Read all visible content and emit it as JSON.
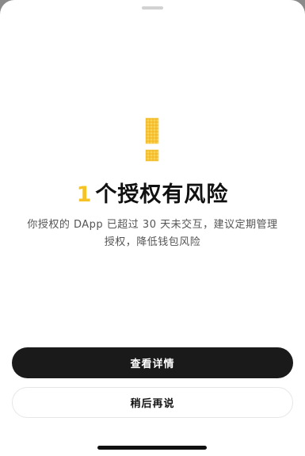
{
  "sheet": {
    "risk_count": "1",
    "title": "个授权有风险",
    "description": "你授权的 DApp 已超过 30 天未交互，建议定期管理授权，降低钱包风险",
    "icon": "warning-exclamation-icon",
    "accent_color": "#f5c327"
  },
  "actions": {
    "view_details_label": "查看详情",
    "later_label": "稍后再说"
  }
}
